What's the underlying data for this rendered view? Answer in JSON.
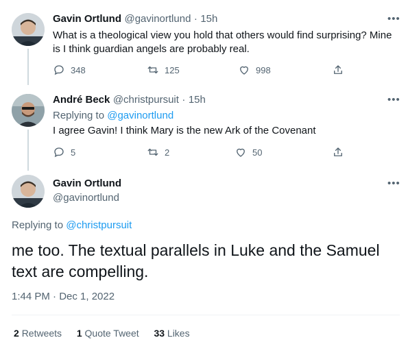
{
  "tweet1": {
    "name": "Gavin Ortlund",
    "handle": "@gavinortlund",
    "time": "15h",
    "text": "What is a theological view you hold that others would find surprising? Mine is I think guardian angels are probably real.",
    "replies": "348",
    "retweets": "125",
    "likes": "998"
  },
  "tweet2": {
    "name": "André Beck",
    "handle": "@christpursuit",
    "time": "15h",
    "replying_label": "Replying to",
    "replying_handle": "@gavinortlund",
    "text": "I agree Gavin! I think Mary is the new Ark of the Covenant",
    "replies": "5",
    "retweets": "2",
    "likes": "50"
  },
  "main": {
    "name": "Gavin Ortlund",
    "handle": "@gavinortlund",
    "replying_label": "Replying to",
    "replying_handle": "@christpursuit",
    "text": "me too. The textual parallels in Luke and the Samuel text are compelling.",
    "timestamp": "1:44 PM · Dec 1, 2022",
    "retweets_count": "2",
    "retweets_label": "Retweets",
    "quotes_count": "1",
    "quotes_label": "Quote Tweet",
    "likes_count": "33",
    "likes_label": "Likes"
  },
  "separator": "·",
  "more_glyph": "•••",
  "colors": {
    "link": "#1d9bf0",
    "muted": "#536471",
    "text": "#0f1419"
  }
}
